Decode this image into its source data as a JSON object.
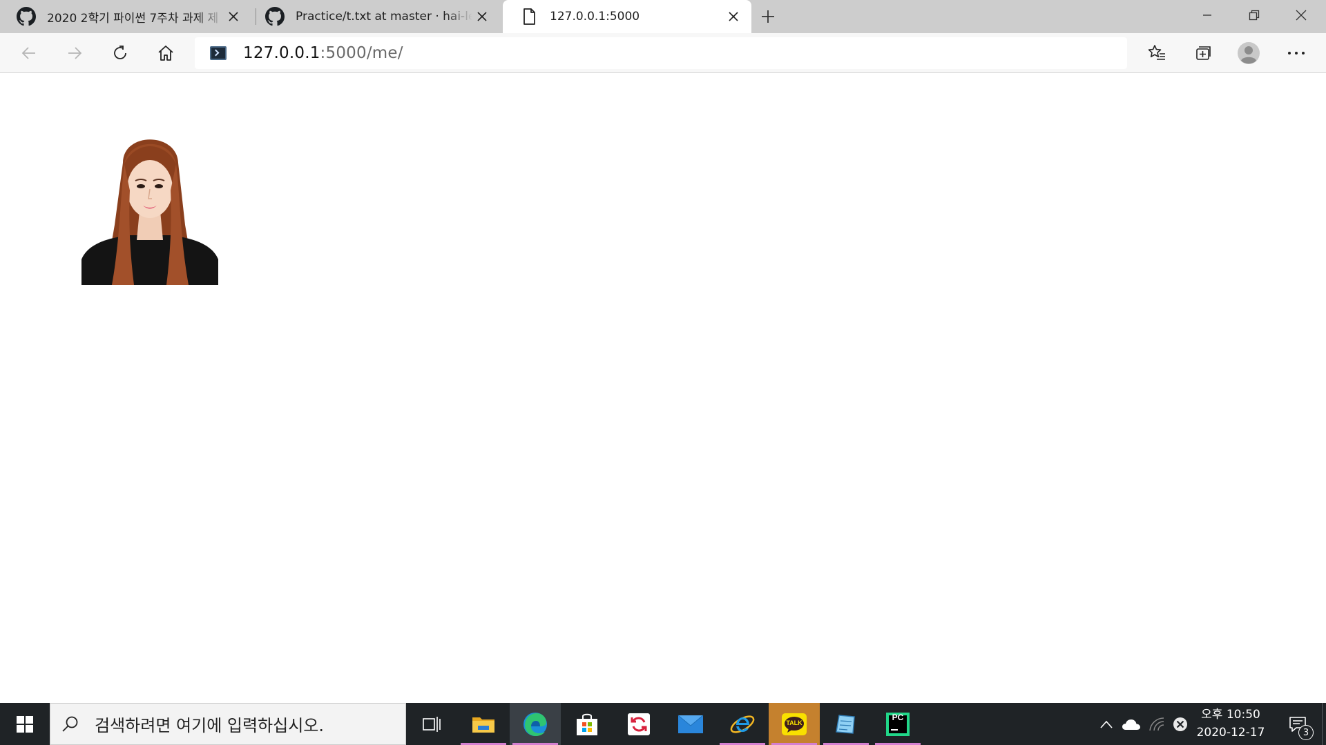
{
  "browser": {
    "tabs": [
      {
        "title": "2020 2학기 파이썬 7주차 과제 제",
        "icon": "github-icon",
        "active": false
      },
      {
        "title": "Practice/t.txt at master · hai-ley/P",
        "icon": "github-icon",
        "active": false
      },
      {
        "title": "127.0.0.1:5000",
        "icon": "page-icon",
        "active": true
      }
    ],
    "address": {
      "host": "127.0.0.1",
      "path": ":5000/me/"
    }
  },
  "page": {
    "image_alt": "ID photo of a woman with long auburn hair wearing a black top"
  },
  "taskbar": {
    "search_placeholder": "검색하려면 여기에 입력하십시오.",
    "pinned_apps": [
      "task-view",
      "file-explorer",
      "edge",
      "microsoft-store",
      "sync-app",
      "mail",
      "internet-explorer",
      "kakaotalk",
      "notepad-app",
      "pycharm"
    ],
    "kakao_label": "TALK",
    "pycharm_label": "PC",
    "clock": {
      "time": "오후 10:50",
      "date": "2020-12-17"
    },
    "notification_count": "3"
  },
  "colors": {
    "tabstrip": "#cdcdcd",
    "toolbar": "#f7f7f7",
    "taskbar": "#1f2326",
    "running_indicator": "#d47fd0"
  }
}
